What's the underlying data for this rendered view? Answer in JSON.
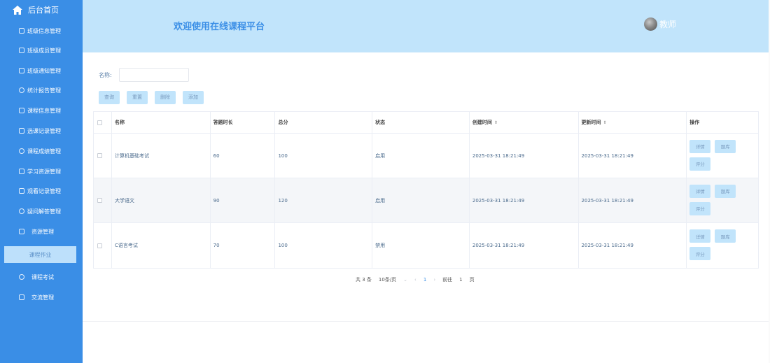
{
  "sidebar": {
    "home_label": "后台首页",
    "items": [
      {
        "label": "班级信息管理",
        "icon": "edit-icon"
      },
      {
        "label": "班级成员管理",
        "icon": "table-icon"
      },
      {
        "label": "班级通知管理",
        "icon": "edit-icon"
      },
      {
        "label": "统计报告管理",
        "icon": "chat-icon"
      },
      {
        "label": "课程信息管理",
        "icon": "table-icon"
      },
      {
        "label": "选课记录管理",
        "icon": "edit-icon"
      },
      {
        "label": "课程成绩管理",
        "icon": "chat-icon"
      },
      {
        "label": "学习资源管理",
        "icon": "edit-icon"
      },
      {
        "label": "观看记录管理",
        "icon": "table-icon"
      },
      {
        "label": "疑问解答管理",
        "icon": "chat-icon"
      },
      {
        "label": "资源管理",
        "icon": "edit-icon"
      },
      {
        "label": "课程作业",
        "icon": ""
      },
      {
        "label": "课程考试",
        "icon": "chat-icon"
      },
      {
        "label": "交流管理",
        "icon": "table-icon"
      }
    ]
  },
  "header": {
    "title": "欢迎使用在线课程平台",
    "user": "教师"
  },
  "search": {
    "name_label": "名称:",
    "name_value": "",
    "name_placeholder": ""
  },
  "toolbar": {
    "query": "查询",
    "reset": "重置",
    "delete": "删除",
    "add": "添加"
  },
  "table": {
    "headers": [
      "名称",
      "答题时长",
      "总分",
      "状态",
      "创建时间",
      "更新时间",
      "操作"
    ],
    "rows": [
      {
        "name": "计算机基础考试",
        "duration": "60",
        "score": "100",
        "status": "启用",
        "created": "2025-03-31 18:21:49",
        "updated": "2025-03-31 18:21:49"
      },
      {
        "name": "大学语文",
        "duration": "90",
        "score": "120",
        "status": "启用",
        "created": "2025-03-31 18:21:49",
        "updated": "2025-03-31 18:21:49"
      },
      {
        "name": "C语言考试",
        "duration": "70",
        "score": "100",
        "status": "禁用",
        "created": "2025-03-31 18:21:49",
        "updated": "2025-03-31 18:21:49"
      }
    ],
    "ops": {
      "detail": "详情",
      "library": "题库",
      "grade": "评分"
    }
  },
  "pagination": {
    "total": "共 3 条",
    "page_size": "10条/页",
    "current": "1",
    "goto_label": "前往",
    "goto_value": "1",
    "page_suffix": "页"
  },
  "colors": {
    "sidebar_bg": "#3a8ee6",
    "header_bg": "#c1e4fb",
    "button_bg": "#c1e4fb",
    "accent": "#3a8ee6"
  }
}
